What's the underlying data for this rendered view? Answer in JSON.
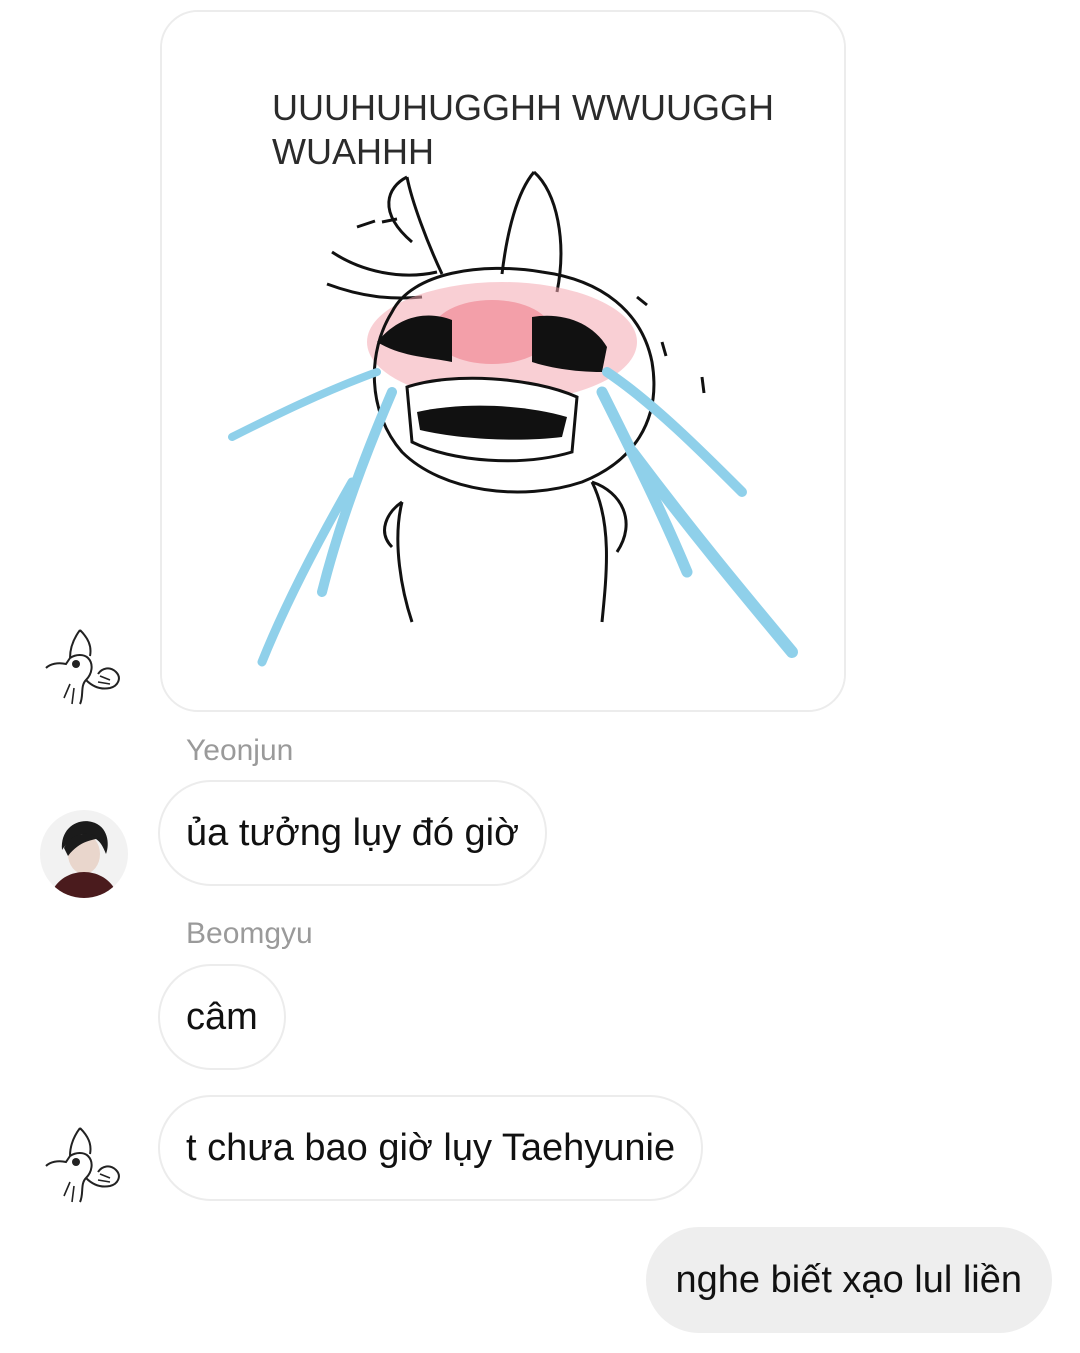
{
  "messages": [
    {
      "type": "image",
      "sticker_caption": "UUUHUHUGGHH WWUUGGH\nWUAHHH",
      "sticker_icon": "crying-bunny-sticker"
    },
    {
      "sender": "Yeonjun",
      "text": "ủa tưởng lụy đó giờ"
    },
    {
      "sender": "Beomgyu",
      "text": "câm"
    },
    {
      "text": "t chưa bao giờ lụy Taehyunie"
    },
    {
      "from_me": true,
      "text": "nghe biết xạo lul liền"
    }
  ],
  "colors": {
    "bubble_border": "#ececec",
    "my_bubble_bg": "#eeeeee",
    "sender_name": "#9a9a9a",
    "tears": "#8fd0ea",
    "blush": "#f4a8b0"
  }
}
